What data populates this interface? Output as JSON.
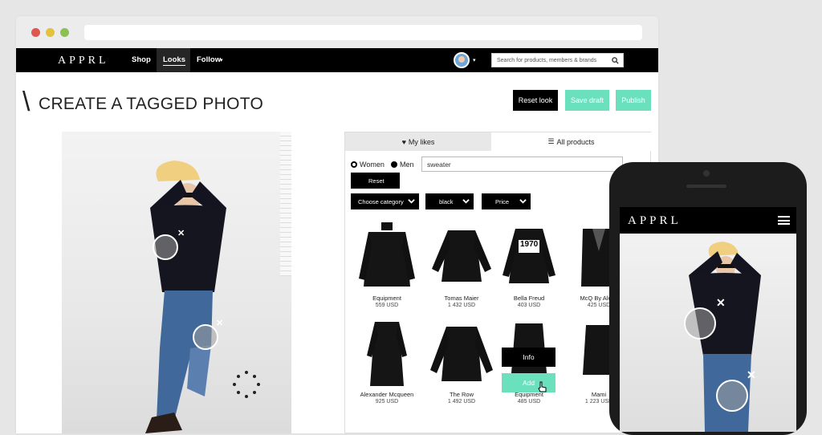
{
  "nav": {
    "logo": "APPRL",
    "shop": "Shop",
    "looks": "Looks",
    "follow": "Follow",
    "follow_caret": "▾",
    "avatar_caret": "▾",
    "search_placeholder": "Search for products, members & brands"
  },
  "page": {
    "slash": "\\",
    "title": "CREATE A TAGGED PHOTO"
  },
  "actions": {
    "reset": "Reset look",
    "save": "Save draft",
    "publish": "Publish"
  },
  "panel": {
    "tab_likes": "My likes",
    "tab_all": "All products",
    "gender_women": "Women",
    "gender_men": "Men",
    "search_value": "sweater",
    "reset": "Reset",
    "filter_category": "Choose category",
    "filter_color": "black",
    "filter_price": "Price",
    "overlay_info": "Info",
    "overlay_add": "Add",
    "products": [
      {
        "name": "Equipment",
        "price": "559 USD"
      },
      {
        "name": "Tomas Maier",
        "price": "1 432 USD"
      },
      {
        "name": "Bella Freud",
        "price": "403 USD",
        "print": "1970"
      },
      {
        "name": "McQ By Alexa",
        "price": "425 USD"
      },
      {
        "name": "Alexander Mcqueen",
        "price": "925 USD"
      },
      {
        "name": "The Row",
        "price": "1 492 USD"
      },
      {
        "name": "Equipment",
        "price": "485 USD"
      },
      {
        "name": "Mami",
        "price": "1 223 USD"
      }
    ]
  },
  "tag_close": "✕",
  "mobile": {
    "logo": "APPRL"
  },
  "colors": {
    "accent": "#6be0bc",
    "nav": "#000000"
  }
}
